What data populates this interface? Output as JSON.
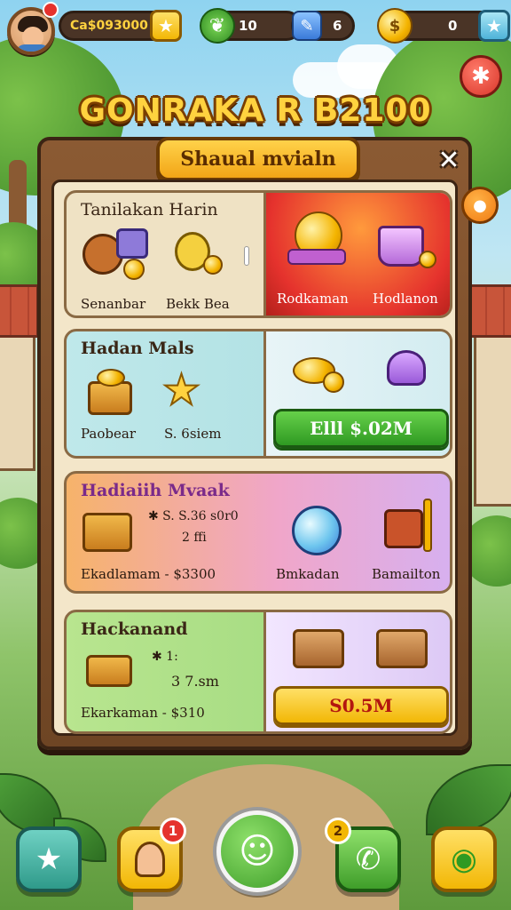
{
  "hud": {
    "player_currency_label": "Ca$093000",
    "leaf_count": "10",
    "pen_count": "6",
    "gold_count": "0"
  },
  "title": "GONRAKA R B2100",
  "panel": {
    "header": "Shaual mvialn",
    "sections": [
      {
        "title": "Tanilakan Harin",
        "items": [
          "Senanbar",
          "Bekk Bea"
        ],
        "featured_items": [
          "Rodkaman",
          "Hodlanon"
        ]
      },
      {
        "title": "Hadan Mals",
        "items": [
          "Paobear",
          "S. 6siem"
        ],
        "price": "Elll $.02M"
      },
      {
        "title": "Hadiaiih Mvaak",
        "info_line1": "✱ S. S.36 s0r0",
        "info_line2": "2 ffi",
        "footer": "Ekadlamam - $3300",
        "items": [
          "Bmkadan",
          "Bamailton"
        ]
      },
      {
        "title": "Hackanand",
        "info_line1": "✱ 1:",
        "info_line2": "3 7.sm",
        "footer": "Ekarkaman - $310",
        "price": "S0.5M"
      }
    ]
  },
  "nav": {
    "profile_badge": "1",
    "chat_badge": "2"
  },
  "colors": {
    "brand_gold": "#ffd23f",
    "wood": "#8b5a33",
    "green_button": "#2f9a22",
    "yellow_button": "#f2b705"
  }
}
